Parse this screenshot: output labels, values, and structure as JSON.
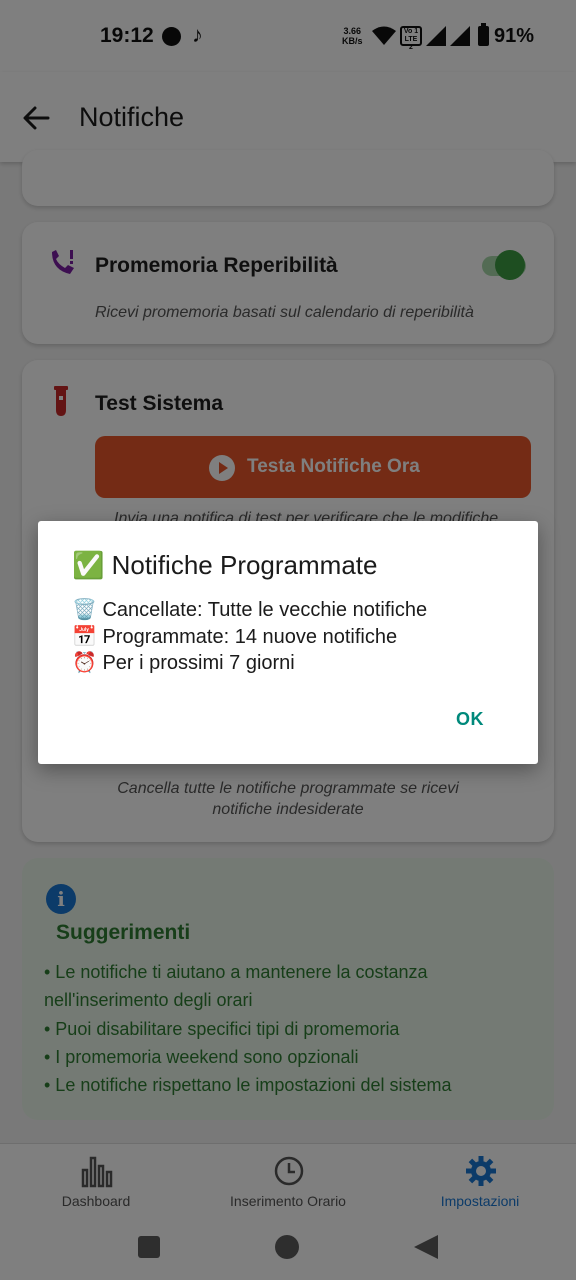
{
  "status_bar": {
    "time": "19:12",
    "net_speed_value": "3.66",
    "net_speed_unit": "KB/s",
    "volte_line1": "Vo 1",
    "volte_line2": "LTE 2",
    "battery_pct": "91%"
  },
  "app_bar": {
    "title": "Notifiche"
  },
  "cards": {
    "reperibilita": {
      "title": "Promemoria Reperibilità",
      "description": "Ricevi promemoria basati sul calendario di reperibilità",
      "enabled": true
    },
    "test": {
      "title": "Test Sistema",
      "button_label": "Testa Notifiche Ora",
      "description_partial": "Invia una notifica di test per verificare che le modifiche",
      "cancel_description": "Cancella tutte le notifiche programmate se ricevi notifiche indesiderate"
    }
  },
  "tips": {
    "title": "Suggerimenti",
    "items": [
      "• Le notifiche ti aiutano a mantenere la costanza nell'inserimento degli orari",
      "• Puoi disabilitare specifici tipi di promemoria",
      "• I promemoria weekend sono opzionali",
      "• Le notifiche rispettano le impostazioni del sistema"
    ]
  },
  "dialog": {
    "title": "✅ Notifiche Programmate",
    "lines": [
      "🗑️ Cancellate: Tutte le vecchie notifiche",
      "📅 Programmate: 14 nuove notifiche",
      "⏰ Per i prossimi 7 giorni"
    ],
    "ok_label": "OK"
  },
  "bottom_nav": {
    "items": [
      {
        "label": "Dashboard",
        "icon": "bar-chart-icon",
        "active": false
      },
      {
        "label": "Inserimento Orario",
        "icon": "clock-icon",
        "active": false
      },
      {
        "label": "Impostazioni",
        "icon": "gear-icon",
        "active": true
      }
    ]
  },
  "colors": {
    "accent_orange": "#e8572a",
    "tips_green": "#2e7d32",
    "active_blue": "#1976d2",
    "dialog_ok_teal": "#00897b"
  }
}
